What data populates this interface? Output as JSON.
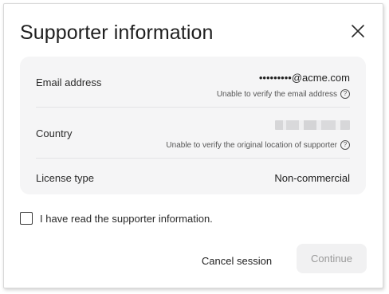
{
  "dialog": {
    "title": "Supporter information",
    "close_icon": "close-icon"
  },
  "info": {
    "email": {
      "label": "Email address",
      "value": "•••••••••@acme.com",
      "note": "Unable to verify the email address",
      "note_icon": "help-circle-icon"
    },
    "country": {
      "label": "Country",
      "value_icon": "blurred-redacted-value",
      "note": "Unable to verify the original location of supporter",
      "note_icon": "help-circle-icon"
    },
    "license": {
      "label": "License type",
      "value": "Non-commercial"
    }
  },
  "confirm": {
    "label": "I have read the supporter information.",
    "checked": false
  },
  "actions": {
    "cancel_label": "Cancel session",
    "continue_label": "Continue",
    "continue_disabled": true
  },
  "colors": {
    "card_bg": "#f5f5f6",
    "disabled_button_bg": "#f1f1f2",
    "disabled_text": "#9a9a9a"
  }
}
